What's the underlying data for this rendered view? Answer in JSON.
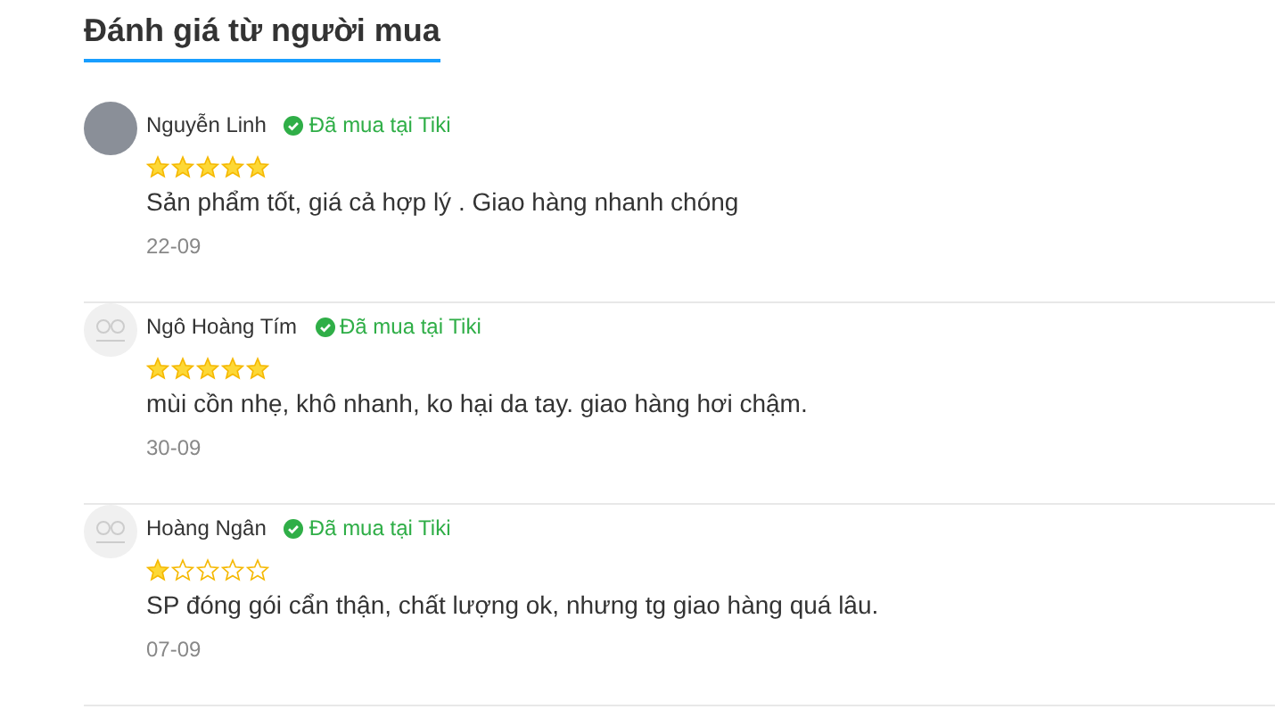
{
  "title": "Đánh giá từ người mua",
  "reviews": [
    {
      "kind": "photo",
      "name": "Nguyễn Linh",
      "verified": "Đã mua tại Tiki",
      "stars": 5,
      "content": "Sản phẩm tốt, giá cả hợp lý . Giao hàng nhanh chóng",
      "date": "22-09"
    },
    {
      "kind": "default",
      "name": "Ngô Hoàng Tím",
      "verified": "Đã mua tại Tiki",
      "stars": 5,
      "content": "mùi cồn nhẹ, khô nhanh, ko hại da tay. giao hàng hơi chậm.",
      "date": "30-09"
    },
    {
      "kind": "default",
      "name": "Hoàng Ngân",
      "verified": "Đã mua tại Tiki",
      "stars": 1,
      "content": "SP đóng gói cẩn thận, chất lượng ok, nhưng tg giao hàng quá lâu.",
      "date": "07-09"
    }
  ]
}
